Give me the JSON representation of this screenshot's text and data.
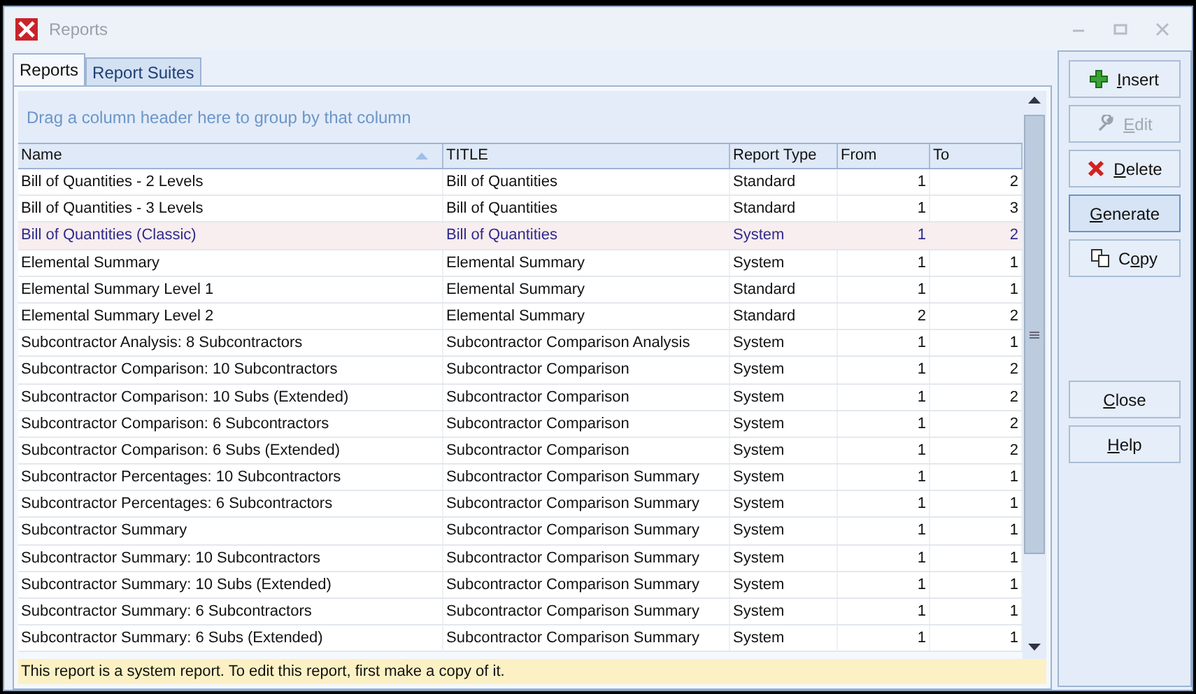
{
  "window": {
    "title": "Reports"
  },
  "tabs": [
    {
      "label": "Reports",
      "selected": true
    },
    {
      "label": "Report Suites",
      "selected": false
    }
  ],
  "group_hint": "Drag a column header here to group by that column",
  "table": {
    "columns": [
      {
        "label": "Name",
        "kind": "text",
        "sorted_ascending": true
      },
      {
        "label": "TITLE",
        "kind": "text",
        "sorted_ascending": false
      },
      {
        "label": "Report Type",
        "kind": "text",
        "sorted_ascending": false
      },
      {
        "label": "From",
        "kind": "number",
        "sorted_ascending": false
      },
      {
        "label": "To",
        "kind": "number",
        "sorted_ascending": false
      }
    ],
    "rows": [
      {
        "cells": [
          "Bill of Quantities - 2 Levels",
          "Bill of Quantities",
          "Standard",
          "1",
          "2"
        ],
        "selected": false
      },
      {
        "cells": [
          "Bill of Quantities - 3 Levels",
          "Bill of Quantities",
          "Standard",
          "1",
          "3"
        ],
        "selected": false
      },
      {
        "cells": [
          "Bill of Quantities (Classic)",
          "Bill of Quantities",
          "System",
          "1",
          "2"
        ],
        "selected": true
      },
      {
        "cells": [
          "Elemental Summary",
          "Elemental Summary",
          "System",
          "1",
          "1"
        ],
        "selected": false
      },
      {
        "cells": [
          "Elemental Summary Level 1",
          "Elemental Summary",
          "Standard",
          "1",
          "1"
        ],
        "selected": false
      },
      {
        "cells": [
          "Elemental Summary Level 2",
          "Elemental Summary",
          "Standard",
          "2",
          "2"
        ],
        "selected": false
      },
      {
        "cells": [
          "Subcontractor Analysis: 8 Subcontractors",
          "Subcontractor Comparison Analysis",
          "System",
          "1",
          "1"
        ],
        "selected": false
      },
      {
        "cells": [
          "Subcontractor Comparison: 10 Subcontractors",
          "Subcontractor Comparison",
          "System",
          "1",
          "2"
        ],
        "selected": false
      },
      {
        "cells": [
          "Subcontractor Comparison: 10 Subs (Extended)",
          "Subcontractor Comparison",
          "System",
          "1",
          "2"
        ],
        "selected": false
      },
      {
        "cells": [
          "Subcontractor Comparison: 6 Subcontractors",
          "Subcontractor Comparison",
          "System",
          "1",
          "2"
        ],
        "selected": false
      },
      {
        "cells": [
          "Subcontractor Comparison: 6 Subs (Extended)",
          "Subcontractor Comparison",
          "System",
          "1",
          "2"
        ],
        "selected": false
      },
      {
        "cells": [
          "Subcontractor Percentages: 10 Subcontractors",
          "Subcontractor Comparison Summary",
          "System",
          "1",
          "1"
        ],
        "selected": false
      },
      {
        "cells": [
          "Subcontractor Percentages: 6 Subcontractors",
          "Subcontractor Comparison Summary",
          "System",
          "1",
          "1"
        ],
        "selected": false
      },
      {
        "cells": [
          "Subcontractor Summary",
          "Subcontractor Comparison Summary",
          "System",
          "1",
          "1"
        ],
        "selected": false
      },
      {
        "cells": [
          "Subcontractor Summary: 10 Subcontractors",
          "Subcontractor Comparison Summary",
          "System",
          "1",
          "1"
        ],
        "selected": false
      },
      {
        "cells": [
          "Subcontractor Summary: 10 Subs (Extended)",
          "Subcontractor Comparison Summary",
          "System",
          "1",
          "1"
        ],
        "selected": false
      },
      {
        "cells": [
          "Subcontractor Summary: 6 Subcontractors",
          "Subcontractor Comparison Summary",
          "System",
          "1",
          "1"
        ],
        "selected": false
      },
      {
        "cells": [
          "Subcontractor Summary: 6 Subs (Extended)",
          "Subcontractor Comparison Summary",
          "System",
          "1",
          "1"
        ],
        "selected": false
      }
    ]
  },
  "status_bar": "This report is a system report. To edit this report, first make a copy of it.",
  "buttons": [
    {
      "kind": "insert",
      "key": "I",
      "post": "nsert",
      "disabled": false,
      "focused": false
    },
    {
      "kind": "edit",
      "key": "E",
      "post": "dit",
      "disabled": true,
      "focused": false
    },
    {
      "kind": "delete",
      "key": "D",
      "post": "elete",
      "disabled": false,
      "focused": false
    },
    {
      "kind": "plain",
      "key": "G",
      "post": "enerate",
      "disabled": false,
      "focused": true
    },
    {
      "kind": "copy",
      "pre": "C",
      "key": "o",
      "post": "py",
      "disabled": false,
      "focused": false
    }
  ],
  "bottom_buttons": [
    {
      "key": "C",
      "post": "lose",
      "disabled": false,
      "focused": false
    },
    {
      "key": "H",
      "post": "elp",
      "disabled": false,
      "focused": false
    }
  ]
}
